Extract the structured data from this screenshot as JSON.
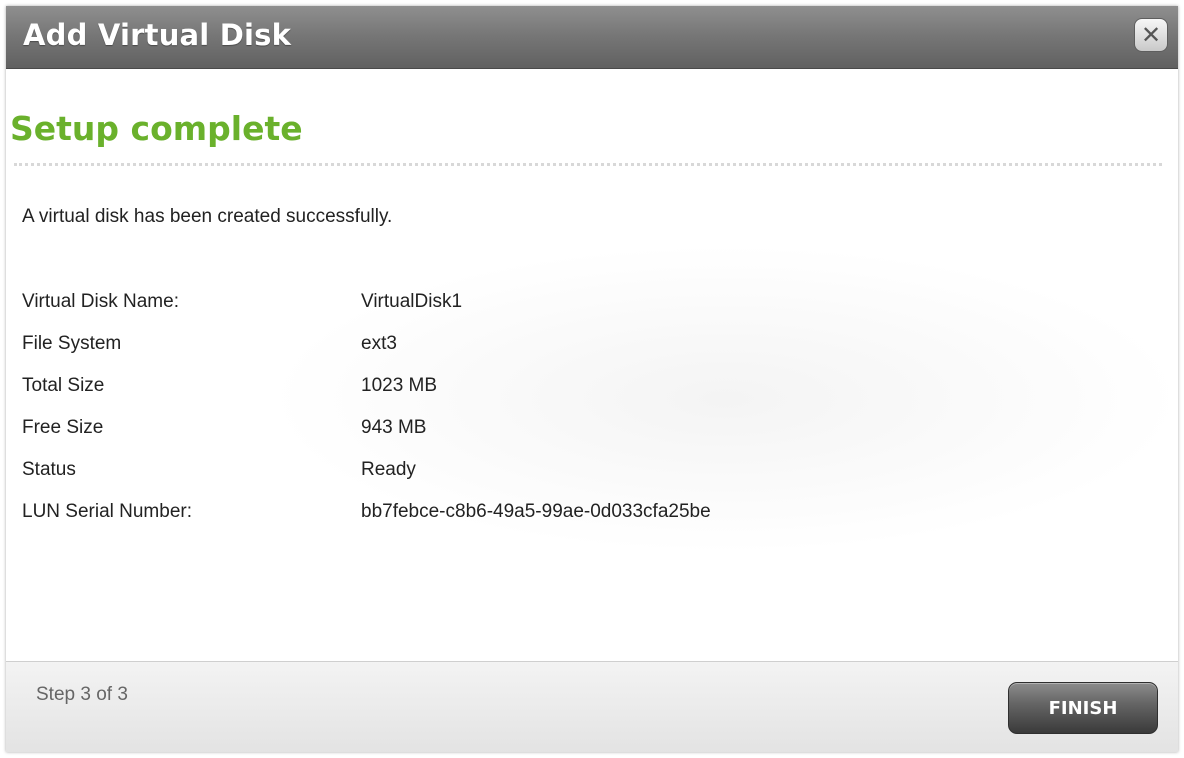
{
  "window": {
    "title": "Add Virtual Disk",
    "close_icon": "close-icon",
    "close_glyph": "✕"
  },
  "main": {
    "heading": "Setup complete",
    "message": "A virtual disk has been created successfully.",
    "details": [
      {
        "label": "Virtual Disk Name:",
        "value": "VirtualDisk1"
      },
      {
        "label": "File System",
        "value": "ext3"
      },
      {
        "label": "Total Size",
        "value": "1023 MB"
      },
      {
        "label": "Free Size",
        "value": "943 MB"
      },
      {
        "label": "Status",
        "value": "Ready"
      },
      {
        "label": "LUN Serial Number:",
        "value": "bb7febce-c8b6-49a5-99ae-0d033cfa25be"
      }
    ]
  },
  "footer": {
    "step": "Step 3 of 3",
    "finish_label": "FINISH"
  },
  "colors": {
    "heading": "#6ab12c",
    "titlebar": "#767676",
    "button": "#4a4a4a"
  }
}
